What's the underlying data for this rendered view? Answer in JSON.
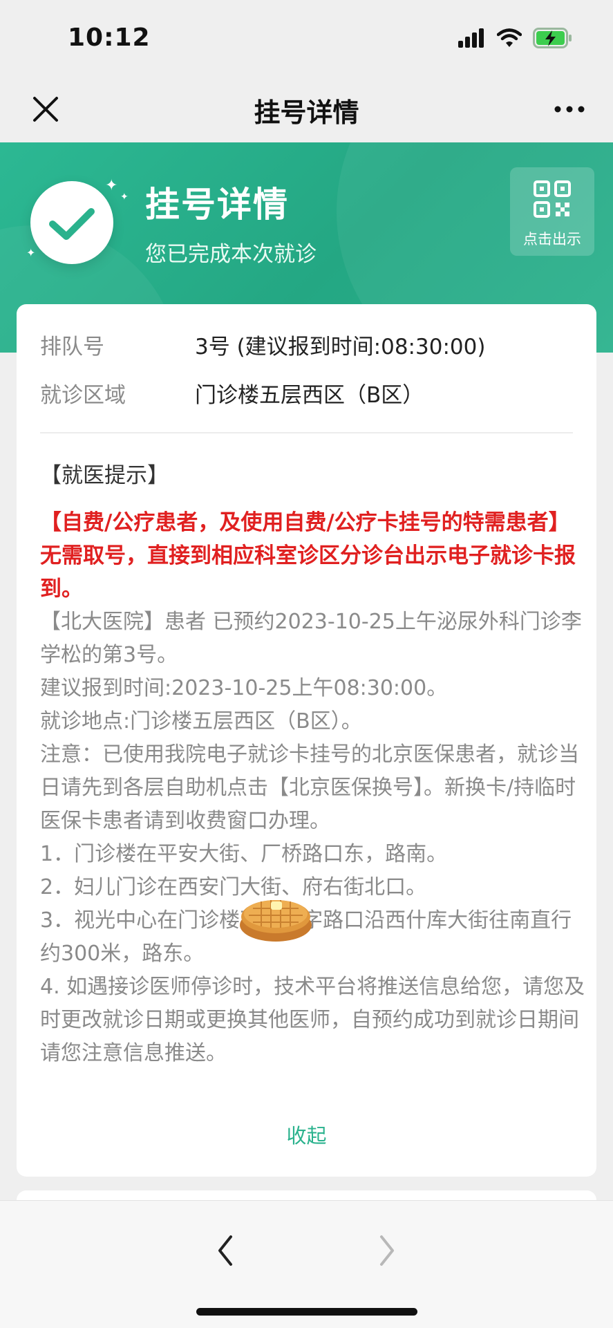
{
  "status_bar": {
    "time": "10:12",
    "icons": [
      "signal-icon",
      "wifi-icon",
      "battery-charging-icon"
    ]
  },
  "nav": {
    "title": "挂号详情",
    "close_icon": "close-icon",
    "more_icon": "more-icon"
  },
  "header": {
    "title": "挂号详情",
    "subtitle": "您已完成本次就诊",
    "qr_label": "点击出示",
    "colors": {
      "primary": "#2ab28d",
      "red_notice": "#e02020"
    }
  },
  "info": {
    "queue_label": "排队号",
    "queue_value": "3号 (建议报到时间:08:30:00)",
    "area_label": "就诊区域",
    "area_value": "门诊楼五层西区（B区）"
  },
  "notice": {
    "title": "【就医提示】",
    "red_text": "【自费/公疗患者，及使用自费/公疗卡挂号的特需患者】无需取号，直接到相应科室诊区分诊台出示电子就诊卡报到。",
    "body": [
      "【北大医院】患者       已预约2023-10-25上午泌尿外科门诊李学松的第3号。",
      "建议报到时间:2023-10-25上午08:30:00。",
      "就诊地点:门诊楼五层西区（B区）。",
      "注意：已使用我院电子就诊卡挂号的北京医保患者，就诊当日请先到各层自助机点击【北京医保换号】。新换卡/持临时医保卡患者请到收费窗口办理。",
      "1．门诊楼在平安大街、厂桥路口东，路南。",
      "2．妇儿门诊在西安门大街、府右街北口。",
      "3．视光中心在门诊楼西侧十字路口沿西什库大街往南直行约300米，路东。",
      "4. 如遇接诊医师停诊时，技术平台将推送信息给您，请您及时更改就诊日期或更换其他医师，自预约成功到就诊日期间请您注意信息推送。"
    ],
    "collapse_label": "收起"
  },
  "bottom_nav": {
    "back_icon": "chevron-left-icon",
    "forward_icon": "chevron-right-icon"
  }
}
